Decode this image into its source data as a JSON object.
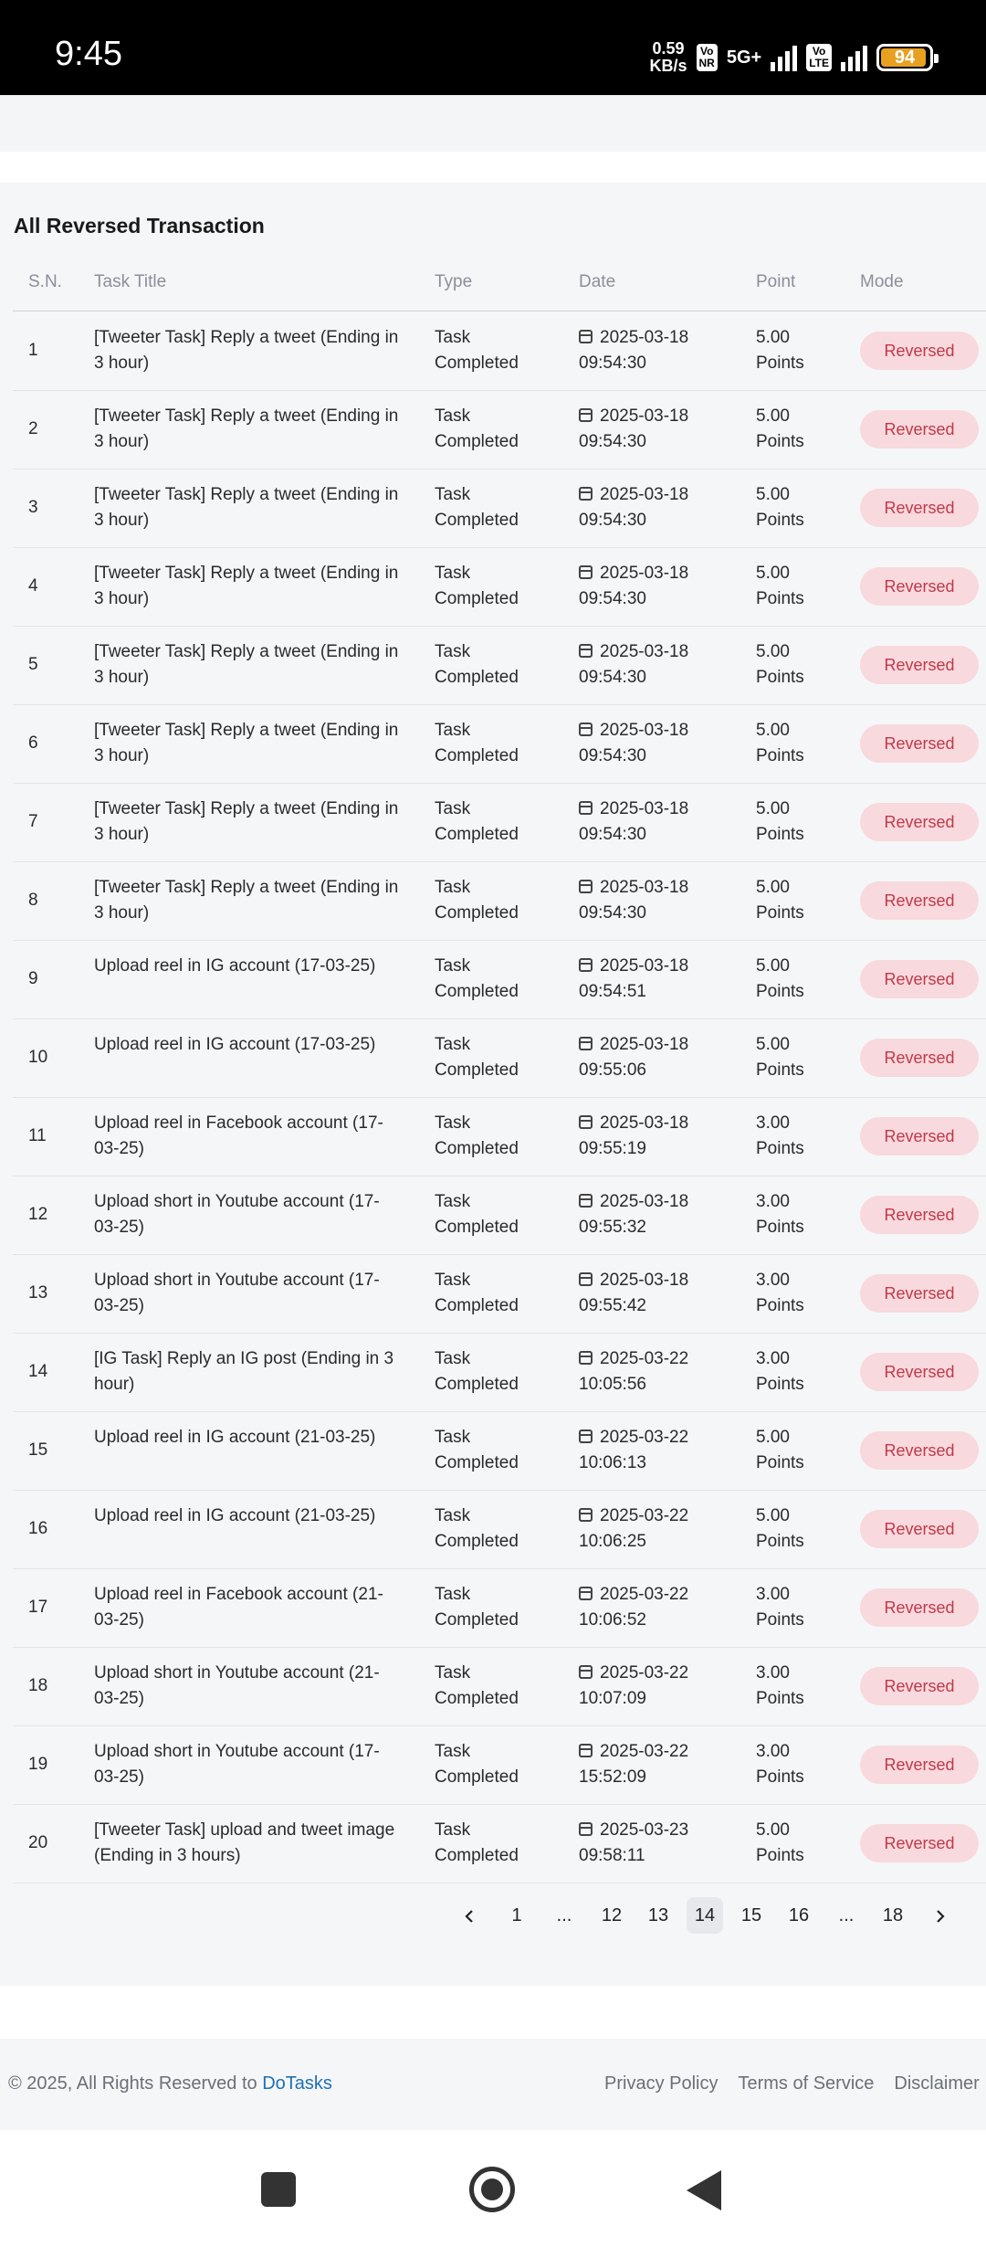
{
  "status_bar": {
    "time": "9:45",
    "net_speed_value": "0.59",
    "net_speed_unit": "KB/s",
    "sim1_chip_top": "Vo",
    "sim1_chip_bottom": "NR",
    "network": "5G+",
    "sim2_chip_top": "Vo",
    "sim2_chip_bottom": "LTE",
    "battery": "94",
    "battery_level": 0.94,
    "battery_color": "#e8a020"
  },
  "card": {
    "title": "All Reversed Transaction",
    "columns": [
      "S.N.",
      "Task Title",
      "Type",
      "Date",
      "Point",
      "Mode"
    ],
    "rows": [
      {
        "sn": "1",
        "title": "[Tweeter Task] Reply a tweet (Ending in 3 hour)",
        "type": "Task Completed",
        "date": "2025-03-18 09:54:30",
        "point": "5.00 Points",
        "mode": "Reversed"
      },
      {
        "sn": "2",
        "title": "[Tweeter Task] Reply a tweet (Ending in 3 hour)",
        "type": "Task Completed",
        "date": "2025-03-18 09:54:30",
        "point": "5.00 Points",
        "mode": "Reversed"
      },
      {
        "sn": "3",
        "title": "[Tweeter Task] Reply a tweet (Ending in 3 hour)",
        "type": "Task Completed",
        "date": "2025-03-18 09:54:30",
        "point": "5.00 Points",
        "mode": "Reversed"
      },
      {
        "sn": "4",
        "title": "[Tweeter Task] Reply a tweet (Ending in 3 hour)",
        "type": "Task Completed",
        "date": "2025-03-18 09:54:30",
        "point": "5.00 Points",
        "mode": "Reversed"
      },
      {
        "sn": "5",
        "title": "[Tweeter Task] Reply a tweet (Ending in 3 hour)",
        "type": "Task Completed",
        "date": "2025-03-18 09:54:30",
        "point": "5.00 Points",
        "mode": "Reversed"
      },
      {
        "sn": "6",
        "title": "[Tweeter Task] Reply a tweet (Ending in 3 hour)",
        "type": "Task Completed",
        "date": "2025-03-18 09:54:30",
        "point": "5.00 Points",
        "mode": "Reversed"
      },
      {
        "sn": "7",
        "title": "[Tweeter Task] Reply a tweet (Ending in 3 hour)",
        "type": "Task Completed",
        "date": "2025-03-18 09:54:30",
        "point": "5.00 Points",
        "mode": "Reversed"
      },
      {
        "sn": "8",
        "title": "[Tweeter Task] Reply a tweet (Ending in 3 hour)",
        "type": "Task Completed",
        "date": "2025-03-18 09:54:30",
        "point": "5.00 Points",
        "mode": "Reversed"
      },
      {
        "sn": "9",
        "title": "Upload reel in IG account (17-03-25)",
        "type": "Task Completed",
        "date": "2025-03-18 09:54:51",
        "point": "5.00 Points",
        "mode": "Reversed"
      },
      {
        "sn": "10",
        "title": "Upload reel in IG account (17-03-25)",
        "type": "Task Completed",
        "date": "2025-03-18 09:55:06",
        "point": "5.00 Points",
        "mode": "Reversed"
      },
      {
        "sn": "11",
        "title": "Upload reel in Facebook account (17-03-25)",
        "type": "Task Completed",
        "date": "2025-03-18 09:55:19",
        "point": "3.00 Points",
        "mode": "Reversed"
      },
      {
        "sn": "12",
        "title": "Upload short in Youtube account (17-03-25)",
        "type": "Task Completed",
        "date": "2025-03-18 09:55:32",
        "point": "3.00 Points",
        "mode": "Reversed"
      },
      {
        "sn": "13",
        "title": "Upload short in Youtube account (17-03-25)",
        "type": "Task Completed",
        "date": "2025-03-18 09:55:42",
        "point": "3.00 Points",
        "mode": "Reversed"
      },
      {
        "sn": "14",
        "title": "[IG Task] Reply an IG post (Ending in 3 hour)",
        "type": "Task Completed",
        "date": "2025-03-22 10:05:56",
        "point": "3.00 Points",
        "mode": "Reversed"
      },
      {
        "sn": "15",
        "title": "Upload reel in IG account (21-03-25)",
        "type": "Task Completed",
        "date": "2025-03-22 10:06:13",
        "point": "5.00 Points",
        "mode": "Reversed"
      },
      {
        "sn": "16",
        "title": "Upload reel in IG account (21-03-25)",
        "type": "Task Completed",
        "date": "2025-03-22 10:06:25",
        "point": "5.00 Points",
        "mode": "Reversed"
      },
      {
        "sn": "17",
        "title": "Upload reel in Facebook account (21-03-25)",
        "type": "Task Completed",
        "date": "2025-03-22 10:06:52",
        "point": "3.00 Points",
        "mode": "Reversed"
      },
      {
        "sn": "18",
        "title": "Upload short in Youtube account (21-03-25)",
        "type": "Task Completed",
        "date": "2025-03-22 10:07:09",
        "point": "3.00 Points",
        "mode": "Reversed"
      },
      {
        "sn": "19",
        "title": "Upload short in Youtube account (17-03-25)",
        "type": "Task Completed",
        "date": "2025-03-22 15:52:09",
        "point": "3.00 Points",
        "mode": "Reversed"
      },
      {
        "sn": "20",
        "title": "[Tweeter Task] upload and tweet image (Ending in 3 hours)",
        "type": "Task Completed",
        "date": "2025-03-23 09:58:11",
        "point": "5.00 Points",
        "mode": "Reversed"
      }
    ]
  },
  "pagination": {
    "prev_icon": "chevron-left-icon",
    "next_icon": "chevron-right-icon",
    "items": [
      "1",
      "...",
      "12",
      "13",
      "14",
      "15",
      "16",
      "...",
      "18"
    ],
    "current": "14"
  },
  "footer": {
    "copyright_prefix": "© 2025, All Rights Reserved to ",
    "brand": "DoTasks",
    "links": [
      "Privacy Policy",
      "Terms of Service",
      "Disclaimer"
    ],
    "brand_color": "#1f6fb5"
  },
  "navbar": {
    "icons": [
      "recents-square-icon",
      "home-circle-icon",
      "back-triangle-icon"
    ]
  },
  "colors": {
    "badge_bg": "#f8d9dd",
    "badge_text": "#c0394b"
  }
}
